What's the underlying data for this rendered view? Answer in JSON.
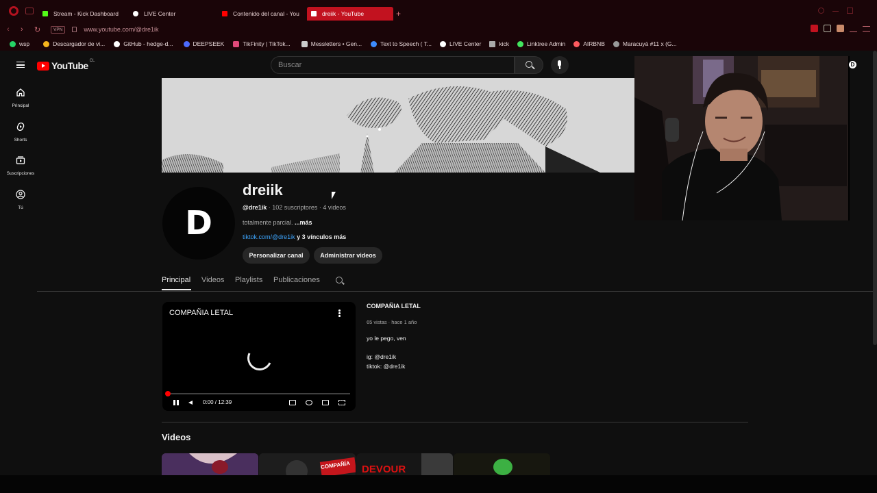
{
  "browser": {
    "tabs": [
      {
        "title": "Stream - Kick Dashboard",
        "color": "#53fc18"
      },
      {
        "title": "LIVE Center",
        "color": "#ffffff"
      },
      {
        "title": "Contenido del canal - You",
        "color": "#ff0000"
      },
      {
        "title": "dreiik - YouTube",
        "color": "#ff0000"
      }
    ],
    "vpn_label": "VPN",
    "url": "www.youtube.com/@dre1ik",
    "bookmarks": [
      {
        "label": "wsp",
        "color": "#25d366"
      },
      {
        "label": "Descargador de vi...",
        "color": "#f5b51d"
      },
      {
        "label": "GitHub - hedge-d...",
        "color": "#ffffff"
      },
      {
        "label": "DEEPSEEK",
        "color": "#4d6bfe"
      },
      {
        "label": "TikFinity | TikTok...",
        "color": "#e04a7a"
      },
      {
        "label": "Messletters • Gen...",
        "color": "#cccccc"
      },
      {
        "label": "Text to Speech ( T...",
        "color": "#3d8bfd"
      },
      {
        "label": "LIVE Center",
        "color": "#ffffff"
      },
      {
        "label": "kick",
        "color": "#aaaaaa"
      },
      {
        "label": "Linktree Admin",
        "color": "#43e55e"
      },
      {
        "label": "AIRBNB",
        "color": "#ff5a5f"
      },
      {
        "label": "Maracuyá #11 x (G...",
        "color": "#999999"
      }
    ]
  },
  "youtube": {
    "logo_text": "YouTube",
    "logo_country": "CL",
    "search_placeholder": "Buscar",
    "guide": [
      {
        "label": "Principal"
      },
      {
        "label": "Shorts"
      },
      {
        "label": "Suscripciones"
      },
      {
        "label": "Tú"
      }
    ],
    "channel": {
      "avatar_letter": "D",
      "name": "dreiik",
      "handle": "@dre1ik",
      "stats": " · 102 suscriptores · 4 videos",
      "description": "totalmente parcial. ",
      "description_more": "...más",
      "link": "tiktok.com/@dre1ik",
      "link_more": " y 3 vínculos más",
      "customize_button": "Personalizar canal",
      "manage_button": "Administrar videos"
    },
    "tabs": [
      "Principal",
      "Videos",
      "Playlists",
      "Publicaciones"
    ],
    "featured": {
      "player_title": "COMPAÑIA LETAL",
      "time": "0:00 / 12:39",
      "progress": 0.0,
      "title": "COMPAÑIA LETAL",
      "meta": "65 vistas · hace 1 año",
      "description": "yo le pego, ven\n\nig: @dre1ik\ntiktok: @dre1ik"
    },
    "videos_section_title": "Videos",
    "thumbnail_texts": [
      "COMPAÑÍA",
      "DEVOUR"
    ]
  }
}
